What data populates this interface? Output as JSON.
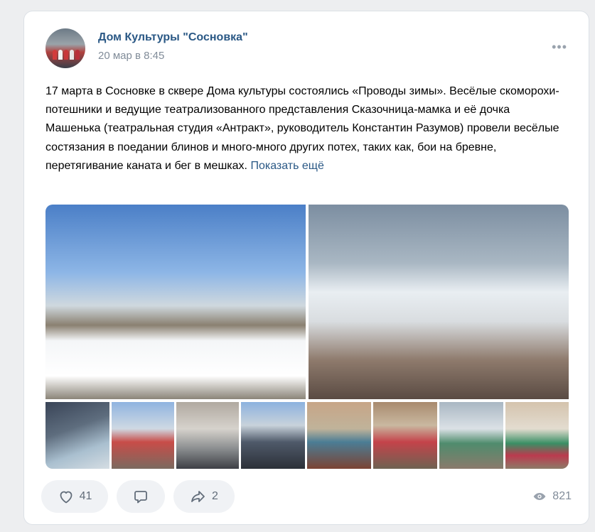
{
  "post": {
    "author": "Дом Культуры \"Сосновка\"",
    "date": "20 мар в 8:45",
    "more_icon": "more-horizontal-icon",
    "text": "17 марта в Сосновке в сквере Дома культуры состоялись «Проводы зимы». Весёлые скоморохи-потешники и ведущие театрализованного представления Сказочница-мамка и её дочка Машенька (театральная студия «Антракт», руководитель Константин Разумов) провели весёлые состязания в поедании блинов и много-много других потех, таких как, бои на бревне, перетягивание каната и бег в мешках.",
    "show_more": "Показать ещё"
  },
  "actions": {
    "likes": "41",
    "shares": "2",
    "views": "821"
  },
  "icons": {
    "like": "heart-icon",
    "comment": "comment-icon",
    "share": "share-arrow-icon",
    "views": "eye-icon"
  },
  "colors": {
    "link": "#2a5885",
    "muted": "#818c99",
    "pill_bg": "#f0f2f5",
    "page_bg": "#edeef0"
  }
}
